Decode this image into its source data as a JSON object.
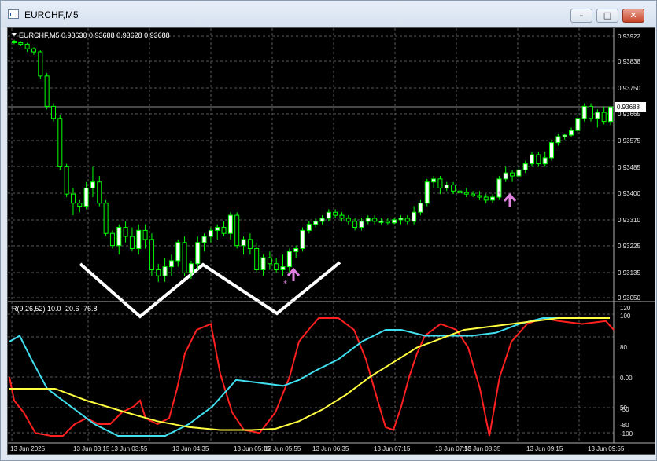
{
  "window": {
    "title": "EURCHF,M5",
    "minimize": "–",
    "maximize": "□",
    "close": "✕"
  },
  "chart": {
    "header": "EURCHF,M5  0.93630 0.93688 0.93628 0.93688",
    "price_scale": [
      "0.93922",
      "0.93838",
      "0.93750",
      "0.93665",
      "0.93575",
      "0.93485",
      "0.93400",
      "0.93310",
      "0.93225",
      "0.93135",
      "0.93050"
    ],
    "current_price": "0.93688",
    "indicator_label": "R(9,26,52) 10.0 -20.6 -76.8",
    "indicator_scale": [
      "120",
      "100",
      "80",
      "50",
      "0.00",
      "-50",
      "-80",
      "-100"
    ],
    "time_labels": [
      "13 Jun 2025",
      "13 Jun 03:15",
      "13 Jun 03:55",
      "13 Jun 04:35",
      "13 Jun 05:15",
      "13 Jun 05:55",
      "13 Jun 06:35",
      "13 Jun 07:15",
      "13 Jun 07:55",
      "13 Jun 08:35",
      "13 Jun 09:15",
      "13 Jun 09:55"
    ]
  },
  "colors": {
    "bull": "#ffffff",
    "bear": "#00ff00",
    "red": "#ff2020",
    "cyan": "#40e0f0",
    "yellow": "#ffff40",
    "arrow": "#e080e0",
    "grid": "#6b6b6b"
  }
}
